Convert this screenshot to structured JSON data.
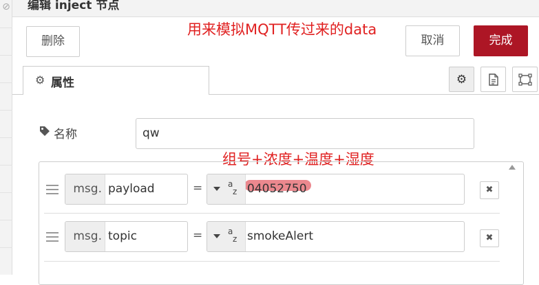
{
  "window": {
    "title": "编辑 inject 节点"
  },
  "buttons": {
    "delete": "删除",
    "cancel": "取消",
    "done": "完成"
  },
  "annotations": {
    "top": "用来模拟MQTT传过来的data",
    "middle": "组号+浓度+温度+湿度"
  },
  "tabs": {
    "properties": "属性"
  },
  "icons": {
    "tab_icon": "gear-icon",
    "settings": "gear-icon",
    "description": "document-icon",
    "appearance": "frame-icon",
    "name": "tag-icon",
    "remove": "close-icon",
    "drag": "drag-handle-icon",
    "type": "string-type-icon"
  },
  "form": {
    "name_label": "名称",
    "name_value": "qw"
  },
  "properties": [
    {
      "prefix": "msg.",
      "property": "payload",
      "equals": "=",
      "type_a": "a",
      "type_z": "z",
      "value": "04052750"
    },
    {
      "prefix": "msg.",
      "property": "topic",
      "equals": "=",
      "type_a": "a",
      "type_z": "z",
      "value": "smokeAlert"
    }
  ],
  "colors": {
    "primary": "#AD1625",
    "annotation": "#e02020"
  }
}
